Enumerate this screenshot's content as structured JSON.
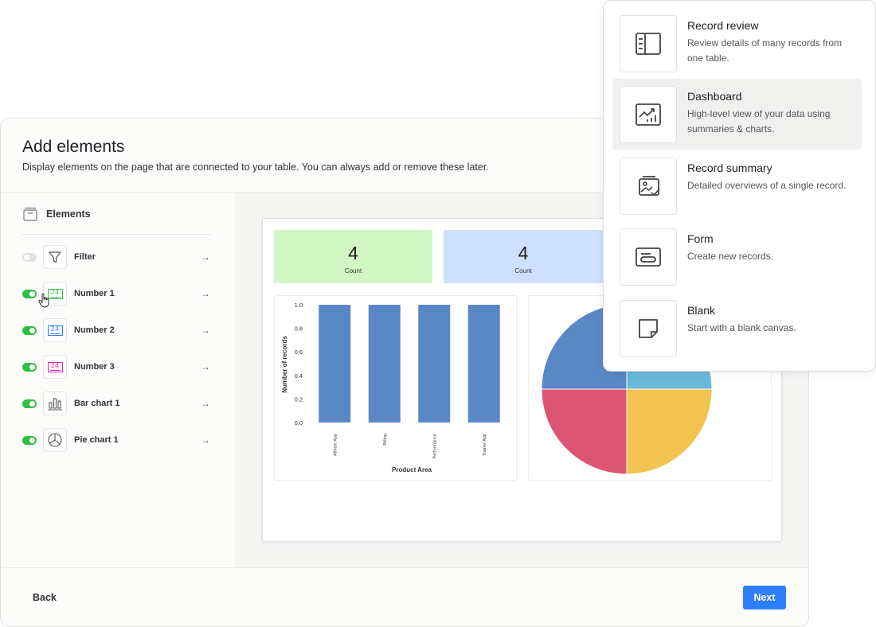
{
  "modal": {
    "title": "Add elements",
    "subtitle": "Display elements on the page that are connected to your table. You can always add or remove these later.",
    "elements_header": "Elements",
    "elements": [
      {
        "label": "Filter",
        "enabled": false,
        "icon": "filter-icon"
      },
      {
        "label": "Number 1",
        "enabled": true,
        "icon": "number-icon",
        "icon_text": "24",
        "color": "#2fbf41"
      },
      {
        "label": "Number 2",
        "enabled": true,
        "icon": "number-icon",
        "icon_text": "24",
        "color": "#2d7ff9"
      },
      {
        "label": "Number 3",
        "enabled": true,
        "icon": "number-icon",
        "icon_text": "24",
        "color": "#e929ba"
      },
      {
        "label": "Bar chart 1",
        "enabled": true,
        "icon": "bar-chart-icon"
      },
      {
        "label": "Pie chart 1",
        "enabled": true,
        "icon": "pie-chart-icon"
      }
    ],
    "arrow_glyph": "→",
    "back_label": "Back",
    "next_label": "Next"
  },
  "preview": {
    "stats": [
      {
        "value": "4",
        "caption": "Count",
        "color": "#d1f7c4"
      },
      {
        "value": "4",
        "caption": "Count",
        "color": "#cfdfff"
      }
    ]
  },
  "chart_data": [
    {
      "type": "bar",
      "categories": [
        "Athlete App",
        "Billing",
        "Performance",
        "Trainer App"
      ],
      "values": [
        1,
        1,
        1,
        1
      ],
      "xlabel": "Product Area",
      "ylabel": "Number of records",
      "ylim": [
        0,
        1.0
      ],
      "yticks": [
        "0.0",
        "0.2",
        "0.4",
        "0.6",
        "0.8",
        "1.0"
      ],
      "color": "#5a87c6"
    },
    {
      "type": "pie",
      "values": [
        1,
        1,
        1,
        1
      ],
      "colors": [
        "#5a87c6",
        "#6ab9da",
        "#f2c34f",
        "#dc5673"
      ]
    }
  ],
  "dropdown": {
    "options": [
      {
        "title": "Record review",
        "desc": "Review details of many records from one table.",
        "icon": "record-review-icon",
        "active": false
      },
      {
        "title": "Dashboard",
        "desc": "High-level view of your data using summaries & charts.",
        "icon": "dashboard-icon",
        "active": true
      },
      {
        "title": "Record summary",
        "desc": "Detailed overviews of a single record.",
        "icon": "record-summary-icon",
        "active": false
      },
      {
        "title": "Form",
        "desc": "Create new records.",
        "icon": "form-icon",
        "active": false
      },
      {
        "title": "Blank",
        "desc": "Start with a blank canvas.",
        "icon": "blank-icon",
        "active": false
      }
    ]
  }
}
